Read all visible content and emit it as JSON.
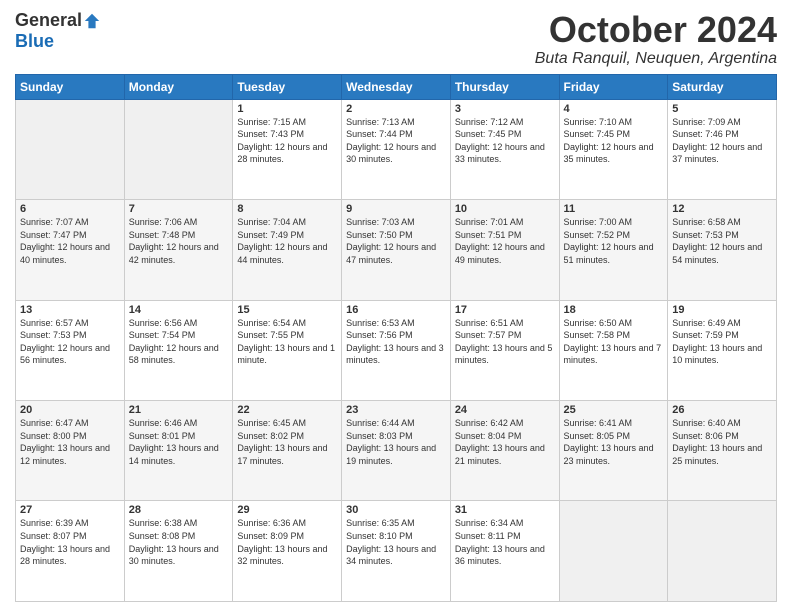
{
  "logo": {
    "general": "General",
    "blue": "Blue"
  },
  "header": {
    "month": "October 2024",
    "location": "Buta Ranquil, Neuquen, Argentina"
  },
  "weekdays": [
    "Sunday",
    "Monday",
    "Tuesday",
    "Wednesday",
    "Thursday",
    "Friday",
    "Saturday"
  ],
  "weeks": [
    [
      {
        "day": "",
        "sunrise": "",
        "sunset": "",
        "daylight": ""
      },
      {
        "day": "",
        "sunrise": "",
        "sunset": "",
        "daylight": ""
      },
      {
        "day": "1",
        "sunrise": "Sunrise: 7:15 AM",
        "sunset": "Sunset: 7:43 PM",
        "daylight": "Daylight: 12 hours and 28 minutes."
      },
      {
        "day": "2",
        "sunrise": "Sunrise: 7:13 AM",
        "sunset": "Sunset: 7:44 PM",
        "daylight": "Daylight: 12 hours and 30 minutes."
      },
      {
        "day": "3",
        "sunrise": "Sunrise: 7:12 AM",
        "sunset": "Sunset: 7:45 PM",
        "daylight": "Daylight: 12 hours and 33 minutes."
      },
      {
        "day": "4",
        "sunrise": "Sunrise: 7:10 AM",
        "sunset": "Sunset: 7:45 PM",
        "daylight": "Daylight: 12 hours and 35 minutes."
      },
      {
        "day": "5",
        "sunrise": "Sunrise: 7:09 AM",
        "sunset": "Sunset: 7:46 PM",
        "daylight": "Daylight: 12 hours and 37 minutes."
      }
    ],
    [
      {
        "day": "6",
        "sunrise": "Sunrise: 7:07 AM",
        "sunset": "Sunset: 7:47 PM",
        "daylight": "Daylight: 12 hours and 40 minutes."
      },
      {
        "day": "7",
        "sunrise": "Sunrise: 7:06 AM",
        "sunset": "Sunset: 7:48 PM",
        "daylight": "Daylight: 12 hours and 42 minutes."
      },
      {
        "day": "8",
        "sunrise": "Sunrise: 7:04 AM",
        "sunset": "Sunset: 7:49 PM",
        "daylight": "Daylight: 12 hours and 44 minutes."
      },
      {
        "day": "9",
        "sunrise": "Sunrise: 7:03 AM",
        "sunset": "Sunset: 7:50 PM",
        "daylight": "Daylight: 12 hours and 47 minutes."
      },
      {
        "day": "10",
        "sunrise": "Sunrise: 7:01 AM",
        "sunset": "Sunset: 7:51 PM",
        "daylight": "Daylight: 12 hours and 49 minutes."
      },
      {
        "day": "11",
        "sunrise": "Sunrise: 7:00 AM",
        "sunset": "Sunset: 7:52 PM",
        "daylight": "Daylight: 12 hours and 51 minutes."
      },
      {
        "day": "12",
        "sunrise": "Sunrise: 6:58 AM",
        "sunset": "Sunset: 7:53 PM",
        "daylight": "Daylight: 12 hours and 54 minutes."
      }
    ],
    [
      {
        "day": "13",
        "sunrise": "Sunrise: 6:57 AM",
        "sunset": "Sunset: 7:53 PM",
        "daylight": "Daylight: 12 hours and 56 minutes."
      },
      {
        "day": "14",
        "sunrise": "Sunrise: 6:56 AM",
        "sunset": "Sunset: 7:54 PM",
        "daylight": "Daylight: 12 hours and 58 minutes."
      },
      {
        "day": "15",
        "sunrise": "Sunrise: 6:54 AM",
        "sunset": "Sunset: 7:55 PM",
        "daylight": "Daylight: 13 hours and 1 minute."
      },
      {
        "day": "16",
        "sunrise": "Sunrise: 6:53 AM",
        "sunset": "Sunset: 7:56 PM",
        "daylight": "Daylight: 13 hours and 3 minutes."
      },
      {
        "day": "17",
        "sunrise": "Sunrise: 6:51 AM",
        "sunset": "Sunset: 7:57 PM",
        "daylight": "Daylight: 13 hours and 5 minutes."
      },
      {
        "day": "18",
        "sunrise": "Sunrise: 6:50 AM",
        "sunset": "Sunset: 7:58 PM",
        "daylight": "Daylight: 13 hours and 7 minutes."
      },
      {
        "day": "19",
        "sunrise": "Sunrise: 6:49 AM",
        "sunset": "Sunset: 7:59 PM",
        "daylight": "Daylight: 13 hours and 10 minutes."
      }
    ],
    [
      {
        "day": "20",
        "sunrise": "Sunrise: 6:47 AM",
        "sunset": "Sunset: 8:00 PM",
        "daylight": "Daylight: 13 hours and 12 minutes."
      },
      {
        "day": "21",
        "sunrise": "Sunrise: 6:46 AM",
        "sunset": "Sunset: 8:01 PM",
        "daylight": "Daylight: 13 hours and 14 minutes."
      },
      {
        "day": "22",
        "sunrise": "Sunrise: 6:45 AM",
        "sunset": "Sunset: 8:02 PM",
        "daylight": "Daylight: 13 hours and 17 minutes."
      },
      {
        "day": "23",
        "sunrise": "Sunrise: 6:44 AM",
        "sunset": "Sunset: 8:03 PM",
        "daylight": "Daylight: 13 hours and 19 minutes."
      },
      {
        "day": "24",
        "sunrise": "Sunrise: 6:42 AM",
        "sunset": "Sunset: 8:04 PM",
        "daylight": "Daylight: 13 hours and 21 minutes."
      },
      {
        "day": "25",
        "sunrise": "Sunrise: 6:41 AM",
        "sunset": "Sunset: 8:05 PM",
        "daylight": "Daylight: 13 hours and 23 minutes."
      },
      {
        "day": "26",
        "sunrise": "Sunrise: 6:40 AM",
        "sunset": "Sunset: 8:06 PM",
        "daylight": "Daylight: 13 hours and 25 minutes."
      }
    ],
    [
      {
        "day": "27",
        "sunrise": "Sunrise: 6:39 AM",
        "sunset": "Sunset: 8:07 PM",
        "daylight": "Daylight: 13 hours and 28 minutes."
      },
      {
        "day": "28",
        "sunrise": "Sunrise: 6:38 AM",
        "sunset": "Sunset: 8:08 PM",
        "daylight": "Daylight: 13 hours and 30 minutes."
      },
      {
        "day": "29",
        "sunrise": "Sunrise: 6:36 AM",
        "sunset": "Sunset: 8:09 PM",
        "daylight": "Daylight: 13 hours and 32 minutes."
      },
      {
        "day": "30",
        "sunrise": "Sunrise: 6:35 AM",
        "sunset": "Sunset: 8:10 PM",
        "daylight": "Daylight: 13 hours and 34 minutes."
      },
      {
        "day": "31",
        "sunrise": "Sunrise: 6:34 AM",
        "sunset": "Sunset: 8:11 PM",
        "daylight": "Daylight: 13 hours and 36 minutes."
      },
      {
        "day": "",
        "sunrise": "",
        "sunset": "",
        "daylight": ""
      },
      {
        "day": "",
        "sunrise": "",
        "sunset": "",
        "daylight": ""
      }
    ]
  ]
}
